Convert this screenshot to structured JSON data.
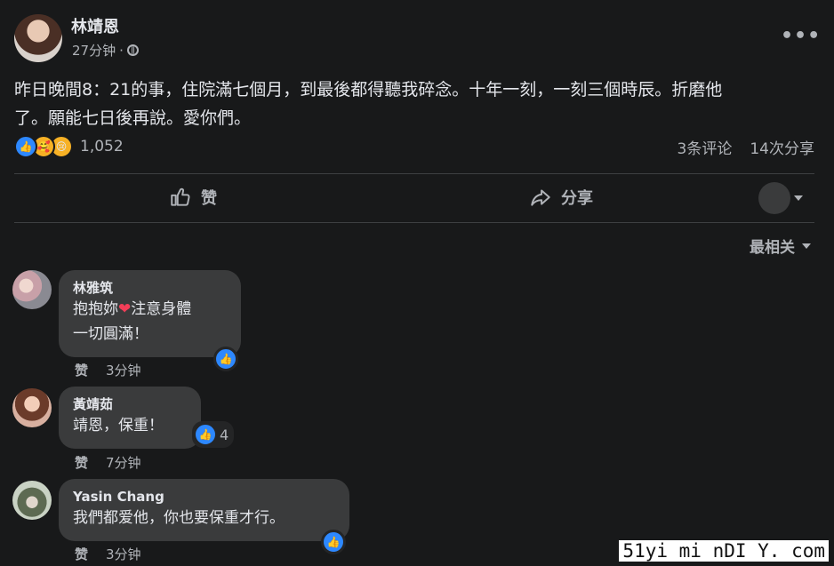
{
  "post": {
    "author": "林靖恩",
    "time": "27分钟",
    "separator": "·",
    "more": "•••",
    "text_line1": "昨日晚間8：21的事，住院滿七個月，到最後都得聽我碎念。十年一刻，一刻三個時辰。折磨他",
    "text_line2": "了。願能七日後再說。愛你們。",
    "reaction_count": "1,052",
    "comments_count": "3条评论",
    "shares_count": "14次分享"
  },
  "actions": {
    "like_label": "赞",
    "share_label": "分享"
  },
  "sort": {
    "label": "最相关"
  },
  "comments": [
    {
      "name": "林雅筑",
      "line1a": "抱抱妳",
      "heart": "❤",
      "line1b": "注意身體",
      "line2": "一切圓滿！",
      "like": "赞",
      "time": "3分钟"
    },
    {
      "name": "黃靖茹",
      "line1": "靖恩，保重！",
      "like_count": "4",
      "like": "赞",
      "time": "7分钟"
    },
    {
      "name": "Yasin Chang",
      "line1": "我們都爱他，你也要保重才行。",
      "like": "赞",
      "time": "3分钟"
    }
  ],
  "icons": {
    "like": "thumbs-up-icon",
    "share": "share-arrow-icon",
    "globe": "globe-icon"
  },
  "colors": {
    "accent": "#2d88ff",
    "bubble": "#3a3b3c",
    "background": "#18191a"
  },
  "watermark": "51yi mi nDI Y. com"
}
